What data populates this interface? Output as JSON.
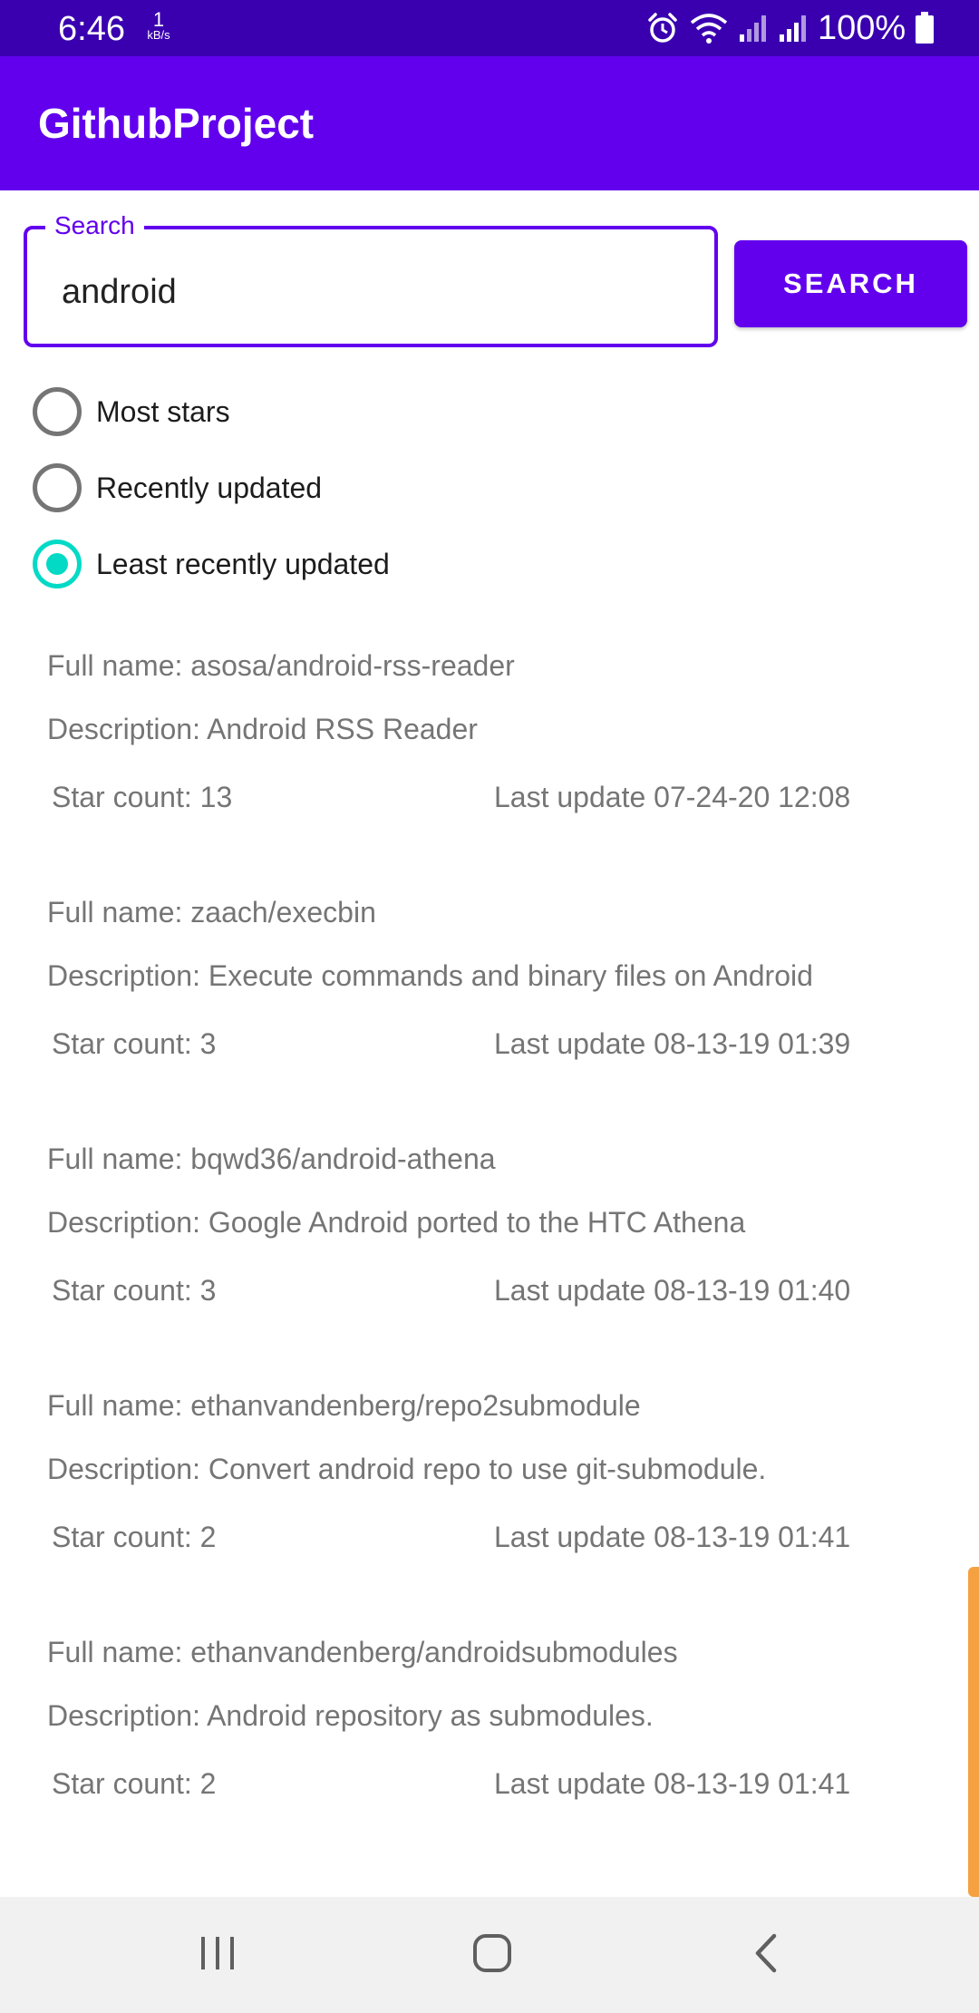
{
  "status_bar": {
    "time": "6:46",
    "net_speed_value": "1",
    "net_speed_unit": "kB/s",
    "battery_percent": "100%",
    "icons": [
      "alarm-icon",
      "wifi-icon",
      "signal-icon",
      "signal-icon",
      "battery-icon"
    ]
  },
  "app_bar": {
    "title": "GithubProject"
  },
  "search": {
    "label": "Search",
    "value": "android",
    "button_label": "SEARCH"
  },
  "sort_options": [
    {
      "label": "Most stars",
      "checked": false
    },
    {
      "label": "Recently updated",
      "checked": false
    },
    {
      "label": "Least recently updated",
      "checked": true
    }
  ],
  "repos": [
    {
      "full_name": "Full name: asosa/android-rss-reader",
      "description": "Description: Android RSS Reader",
      "star_count": "Star count: 13",
      "last_update": "Last update 07-24-20 12:08"
    },
    {
      "full_name": "Full name: zaach/execbin",
      "description": "Description: Execute commands and binary files on Android",
      "star_count": "Star count: 3",
      "last_update": "Last update 08-13-19 01:39"
    },
    {
      "full_name": "Full name: bqwd36/android-athena",
      "description": "Description: Google Android ported to the HTC Athena",
      "star_count": "Star count: 3",
      "last_update": "Last update 08-13-19 01:40"
    },
    {
      "full_name": "Full name: ethanvandenberg/repo2submodule",
      "description": "Description: Convert android repo to use git-submodule.",
      "star_count": "Star count: 2",
      "last_update": "Last update 08-13-19 01:41"
    },
    {
      "full_name": "Full name: ethanvandenberg/androidsubmodules",
      "description": "Description: Android repository as submodules.",
      "star_count": "Star count: 2",
      "last_update": "Last update 08-13-19 01:41"
    }
  ],
  "colors": {
    "primary": "#6200ee",
    "status_bar": "#3a00b0",
    "accent": "#03dac5",
    "scrollbar": "#f5a142"
  },
  "nav_bar": {
    "buttons": [
      "recents-icon",
      "home-icon",
      "back-icon"
    ]
  }
}
